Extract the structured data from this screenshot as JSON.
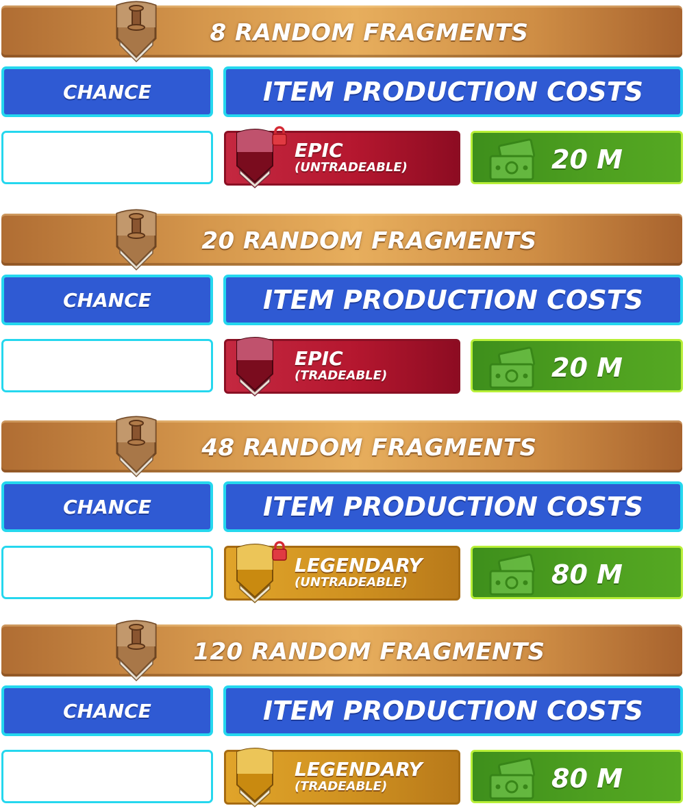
{
  "colors": {
    "header_bronze": "#d5974c",
    "blue_panel": "#2f5ad3",
    "cyan_border": "#25d7ee",
    "epic_red": "#b5172f",
    "legendary_gold": "#cf9120",
    "cost_green": "#4ea020"
  },
  "sections": [
    {
      "title": "8 RANDOM FRAGMENTS",
      "chance_label": "CHANCE",
      "costs_label": "ITEM PRODUCTION COSTS",
      "item": {
        "rarity": "EPIC",
        "trade": "(UNTRADEABLE)",
        "locked": true,
        "icon": "epic-crest-icon"
      },
      "cost": "20 M"
    },
    {
      "title": "20 RANDOM FRAGMENTS",
      "chance_label": "CHANCE",
      "costs_label": "ITEM PRODUCTION COSTS",
      "item": {
        "rarity": "EPIC",
        "trade": "(TRADEABLE)",
        "locked": false,
        "icon": "epic-crest-icon"
      },
      "cost": "20 M"
    },
    {
      "title": "48 RANDOM FRAGMENTS",
      "chance_label": "CHANCE",
      "costs_label": "ITEM PRODUCTION COSTS",
      "item": {
        "rarity": "LEGENDARY",
        "trade": "(UNTRADEABLE)",
        "locked": true,
        "icon": "legendary-crest-icon"
      },
      "cost": "80 M"
    },
    {
      "title": "120 RANDOM FRAGMENTS",
      "chance_label": "CHANCE",
      "costs_label": "ITEM PRODUCTION COSTS",
      "item": {
        "rarity": "LEGENDARY",
        "trade": "(TRADEABLE)",
        "locked": false,
        "icon": "legendary-crest-icon"
      },
      "cost": "80 M"
    }
  ]
}
